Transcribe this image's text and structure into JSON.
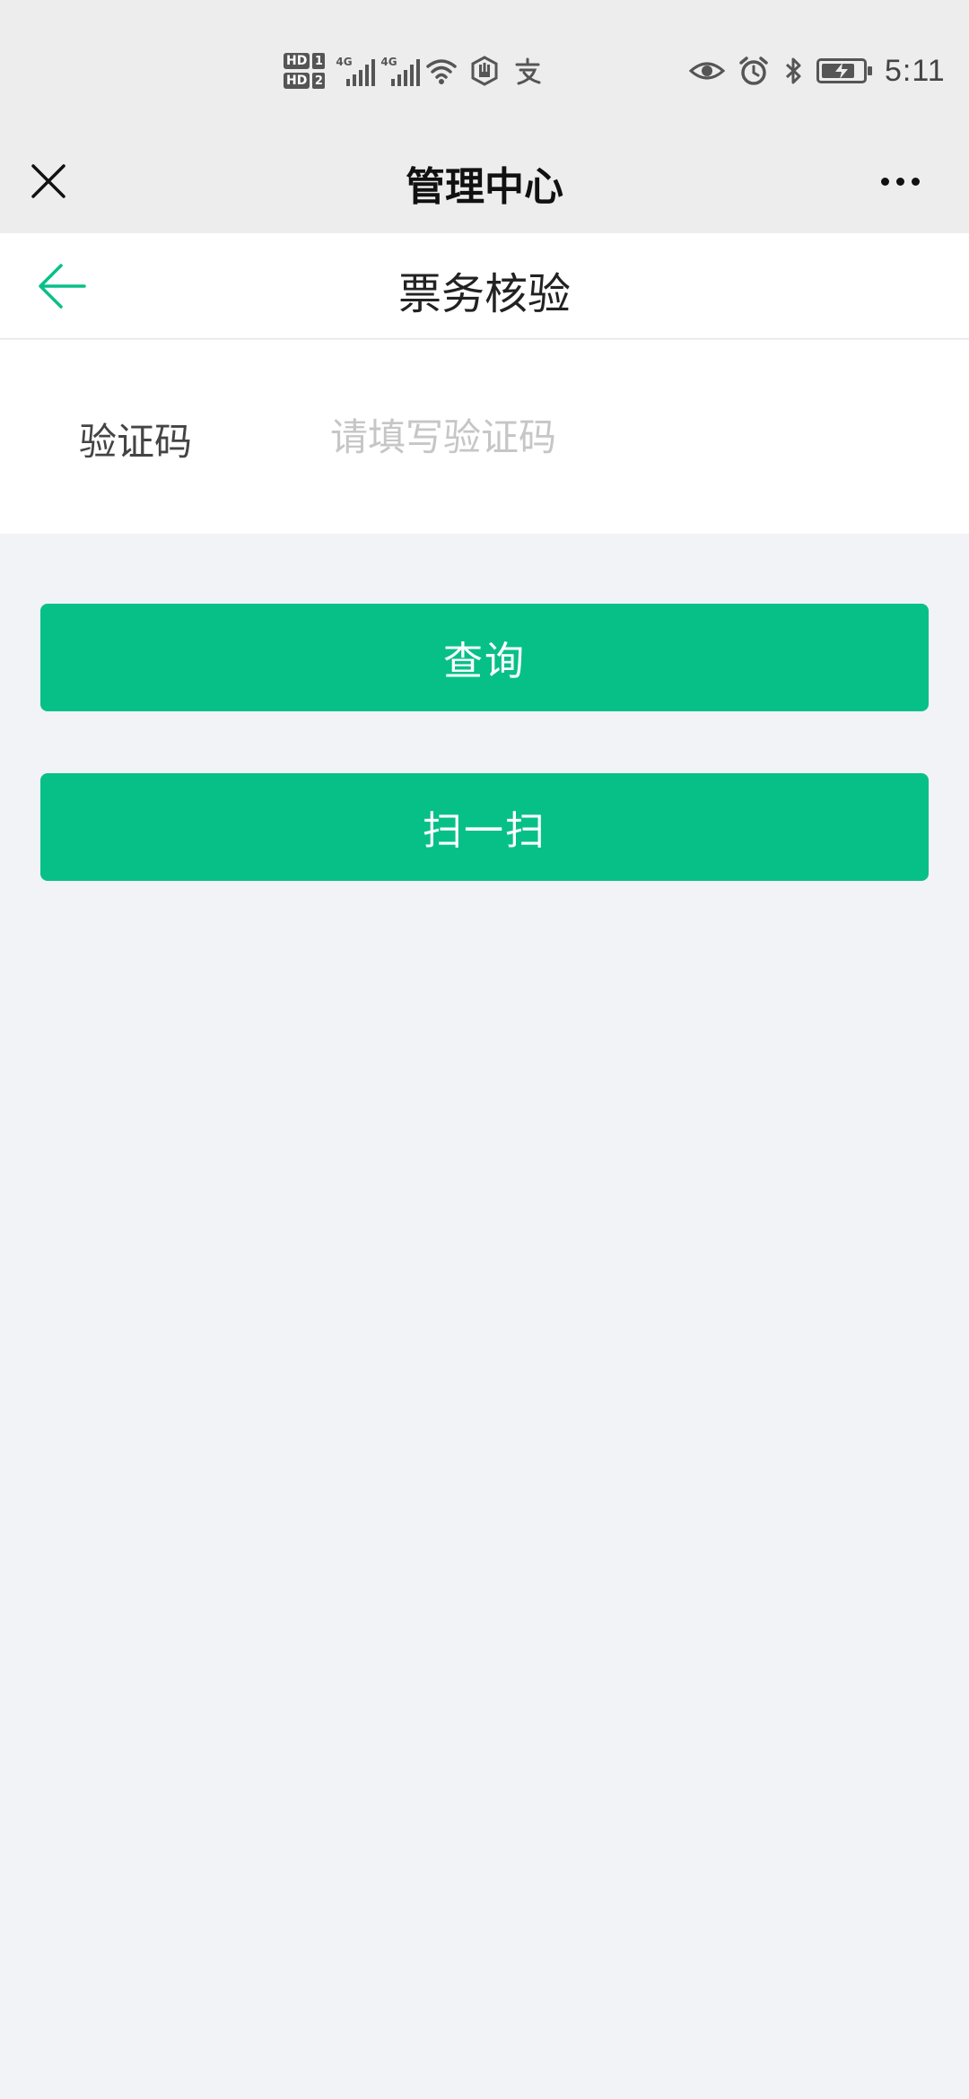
{
  "status_bar": {
    "sim1_label": "HD",
    "sim1_slot": "1",
    "sim2_label": "HD",
    "sim2_slot": "2",
    "network1": "4G",
    "network2": "4G",
    "time": "5:11",
    "icons": [
      "wifi-icon",
      "hand-icon",
      "alipay-icon",
      "eye-icon",
      "alarm-icon",
      "bluetooth-icon",
      "battery-icon"
    ]
  },
  "title_bar": {
    "title": "管理中心",
    "close_icon": "close-icon",
    "more_icon": "more-icon"
  },
  "nav_bar": {
    "title": "票务核验",
    "back_icon": "arrow-left-icon"
  },
  "form": {
    "code_label": "验证码",
    "code_value": "",
    "code_placeholder": "请填写验证码"
  },
  "actions": {
    "query_label": "查询",
    "scan_label": "扫一扫"
  },
  "colors": {
    "accent": "#07c088",
    "back_arrow": "#07c088",
    "page_bg": "#f1f3f6",
    "bar_bg": "#ededed"
  }
}
